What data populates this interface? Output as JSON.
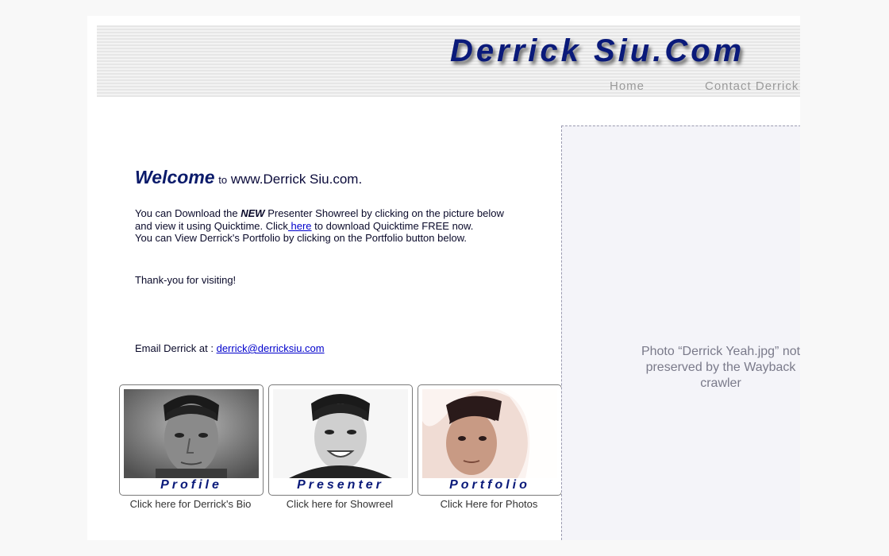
{
  "header": {
    "title": "Derrick Siu.Com",
    "nav": {
      "home": "Home",
      "contact": "Contact Derrick"
    }
  },
  "welcome": {
    "word": "Welcome",
    "to": "to",
    "site": "www.Derrick Siu.com."
  },
  "intro": {
    "part1": "You can Download the ",
    "new_word": "NEW",
    "part2": " Presenter Showreel by clicking on the picture below and view it using Quicktime. Click",
    "link": " here",
    "part3": " to download Quicktime FREE now.",
    "portfolio_line": "You can View Derrick's Portfolio by clicking on the Portfolio button below.",
    "thanks": "Thank-you for visiting!"
  },
  "email": {
    "label": "Email Derrick at :",
    "address": "derrick@derricksiu.com"
  },
  "cards": [
    {
      "label": "Profile",
      "caption": "Click here for Derrick's Bio"
    },
    {
      "label": "Presenter",
      "caption": "Click here for Showreel"
    },
    {
      "label": "Portfolio",
      "caption": "Click Here for Photos"
    }
  ],
  "photo_placeholder": {
    "text": "Photo “Derrick Yeah.jpg” not preserved by the Wayback crawler"
  },
  "colors": {
    "brand_blue": "#0a1a7a",
    "link_blue": "#0000cc",
    "nav_gray": "#9a9a9a"
  }
}
